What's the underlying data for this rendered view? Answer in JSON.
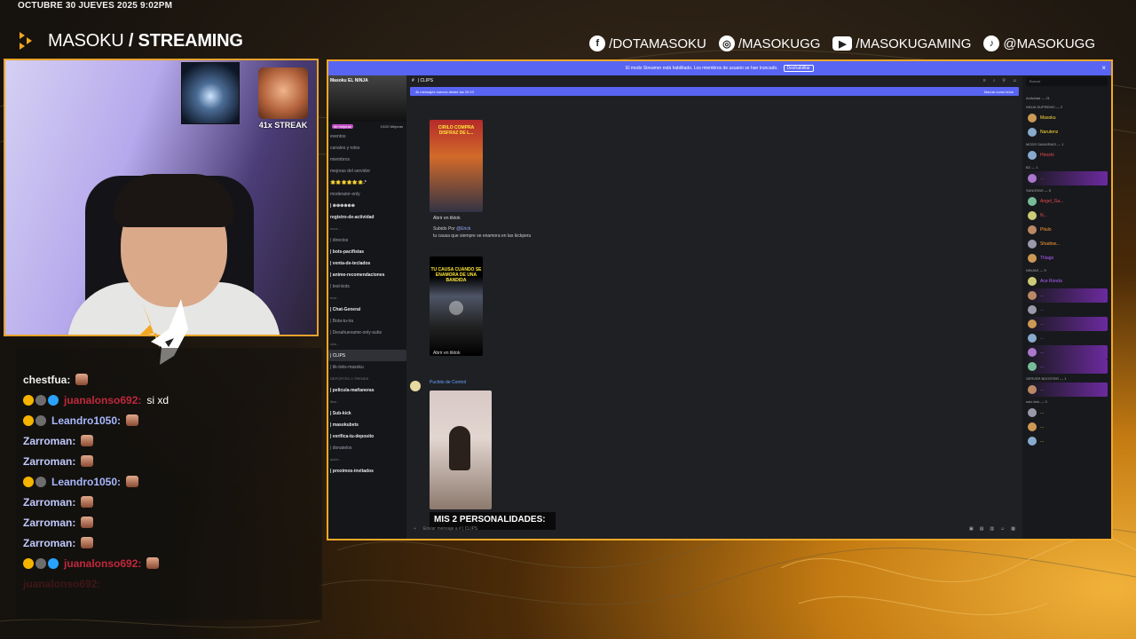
{
  "stream": {
    "datetime": "OCTUBRE 30 JUEVES 2025 9:02PM",
    "brand_light": "MASOKU",
    "brand_bold": "/ STREAMING",
    "socials": [
      {
        "icon": "facebook-icon",
        "label": "/DOTAMASOKU",
        "glyph": "f"
      },
      {
        "icon": "instagram-icon",
        "label": "/MASOKUGG",
        "glyph": "◎"
      },
      {
        "icon": "youtube-icon",
        "label": "/MASOKUGAMING",
        "glyph": "▶"
      },
      {
        "icon": "tiktok-icon",
        "label": "@MASOKUGG",
        "glyph": "♪"
      }
    ],
    "streak_label": "41x STREAK"
  },
  "chat": {
    "lines": [
      {
        "user": "chestfua:",
        "msg": "",
        "color": "white",
        "badges": 0,
        "emote": true
      },
      {
        "user": "juanalonso692:",
        "msg": "si xd",
        "color": "red",
        "badges": 3,
        "emote": false
      },
      {
        "user": "Leandro1050:",
        "msg": "",
        "color": "blue",
        "badges": 2,
        "emote": true
      },
      {
        "user": "Zarroman:",
        "msg": "",
        "color": "violet",
        "badges": 0,
        "emote": true
      },
      {
        "user": "Zarroman:",
        "msg": "",
        "color": "violet",
        "badges": 0,
        "emote": true
      },
      {
        "user": "Leandro1050:",
        "msg": "",
        "color": "blue",
        "badges": 2,
        "emote": true
      },
      {
        "user": "Zarroman:",
        "msg": "",
        "color": "violet",
        "badges": 0,
        "emote": true
      },
      {
        "user": "Zarroman:",
        "msg": "",
        "color": "violet",
        "badges": 0,
        "emote": true
      },
      {
        "user": "Zarroman:",
        "msg": "",
        "color": "violet",
        "badges": 0,
        "emote": true
      },
      {
        "user": "juanalonso692:",
        "msg": "",
        "color": "red",
        "badges": 3,
        "emote": true
      }
    ]
  },
  "discord": {
    "banner_text": "El modo Streamer está habilitado. Los miembros de usuario se han truncado.",
    "banner_button": "Deshabilitar",
    "server_name": "Masoku EL NINJA",
    "boost_left": "de mejoras",
    "boost_right": "10/20 Mejoras",
    "channels": [
      {
        "label": "eventos",
        "style": ""
      },
      {
        "label": "canales y roles",
        "style": ""
      },
      {
        "label": "miembros",
        "style": ""
      },
      {
        "label": "mejoras del servidor",
        "style": ""
      },
      {
        "label": "🌟🌟🌟🌟🌟🌟.*",
        "style": "b"
      },
      {
        "label": "moderator-only",
        "style": ""
      },
      {
        "label": "| ⊕⊕⊕⊕⊕⊕",
        "style": "b"
      },
      {
        "label": "registro-de-actividad",
        "style": "b"
      },
      {
        "label": "ecos -",
        "style": "cat"
      },
      {
        "label": "| directos",
        "style": ""
      },
      {
        "label": "| bots-pacifistas",
        "style": "b"
      },
      {
        "label": "| venta-de-teclados",
        "style": "b"
      },
      {
        "label": "| anime-recomendaciones",
        "style": "b"
      },
      {
        "label": "| test-bots",
        "style": ""
      },
      {
        "label": "eral -",
        "style": "cat"
      },
      {
        "label": "| Chat-General",
        "style": "b"
      },
      {
        "label": "| Bota-tu-ira",
        "style": ""
      },
      {
        "label": "| Desahuevame-only-subs",
        "style": ""
      },
      {
        "label": "ccio -",
        "style": "cat"
      },
      {
        "label": "| CLIPS",
        "style": "sel"
      },
      {
        "label": "| tik-toks-masoku",
        "style": ""
      },
      {
        "label": "DEPORTES-Y-TRENDS",
        "style": "cat"
      },
      {
        "label": "| pelicula-mañaneras",
        "style": "b"
      },
      {
        "label": "ifica -",
        "style": "cat"
      },
      {
        "label": "| Sub-kick",
        "style": "b"
      },
      {
        "label": "| masokubets",
        "style": "b"
      },
      {
        "label": "| verifica-tu-deposito",
        "style": "b"
      },
      {
        "label": "| donatelos",
        "style": ""
      },
      {
        "label": "ación -",
        "style": "cat"
      },
      {
        "label": "| proximos-invitados",
        "style": "b"
      }
    ],
    "channel_title": "| CLIPS",
    "new_msgs_text": "4k mensajes nuevos desde las 20:10",
    "mark_read": "Marcar como leído",
    "clip1_caption": "CIRILO COMPRA DISFRAZ DE L...",
    "open_tiktok": "Abrir en tiktok",
    "uploaded_by": "Subido Por",
    "uploader": "@Erick",
    "upload_msg": "tu causa que siempre se enamora en las kickperu",
    "clip2_caption": "TU CAUSA CUANDO SE ENAMORA DE UNA BANDIDA",
    "poster": "Puchito de Control",
    "clip3_caption": "MIS 2 PERSONALIDADES:",
    "composer_placeholder": "Enviar mensaje a # | CLIPS",
    "search_placeholder": "Buscar",
    "activity": "Actividad — 21",
    "member_groups": [
      {
        "title": "NINJA SUPREMO — 2",
        "members": [
          {
            "name": "Masoku",
            "color": "y",
            "hl": false
          },
          {
            "name": "Narutenz",
            "color": "y",
            "hl": false
          }
        ]
      },
      {
        "title": "MODS SAMURAIS — 1",
        "members": [
          {
            "name": "Hiroshi",
            "color": "r",
            "hl": false
          }
        ]
      },
      {
        "title": "BZ — 1",
        "members": [
          {
            "name": "...",
            "color": "r",
            "hl": true
          }
        ]
      },
      {
        "title": "SANGRAS — 5",
        "members": [
          {
            "name": "Angel_Ga...",
            "color": "r",
            "hl": false
          },
          {
            "name": "N...",
            "color": "r",
            "hl": false
          },
          {
            "name": "Pitulo",
            "color": "o",
            "hl": false
          },
          {
            "name": "Shadow...",
            "color": "o",
            "hl": false
          },
          {
            "name": "Thiago",
            "color": "p",
            "hl": false
          }
        ]
      },
      {
        "title": "NINJAS — 9",
        "members": [
          {
            "name": "Ace Ronda",
            "color": "p",
            "hl": false
          },
          {
            "name": "...",
            "color": "p",
            "hl": true
          },
          {
            "name": "...",
            "color": "p",
            "hl": false
          },
          {
            "name": "...",
            "color": "p",
            "hl": true
          },
          {
            "name": "...",
            "color": "p",
            "hl": false
          },
          {
            "name": "...",
            "color": "p",
            "hl": true
          },
          {
            "name": "...",
            "color": "p",
            "hl": true
          }
        ]
      },
      {
        "title": "SERVER BOOSTER — 1",
        "members": [
          {
            "name": "...",
            "color": "p",
            "hl": true
          }
        ]
      },
      {
        "title": "solo kick — 3",
        "members": [
          {
            "name": "...",
            "color": "y",
            "hl": false
          },
          {
            "name": "...",
            "color": "y",
            "hl": false
          },
          {
            "name": "...",
            "color": "y",
            "hl": false
          }
        ]
      }
    ]
  }
}
